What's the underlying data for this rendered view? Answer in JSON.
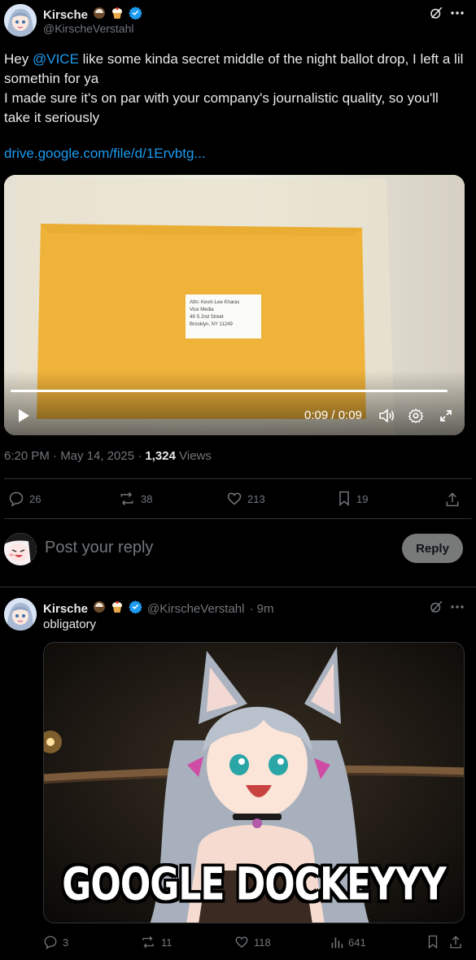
{
  "tweet": {
    "author_name": "Kirsche",
    "author_handle": "@KirscheVerstahl",
    "text_prefix": "Hey ",
    "mention": "@VICE",
    "text_rest": " like some kinda secret middle of the night ballot drop, I left a lil somethin for ya",
    "text_line2": "I made sure it's on par with your company's journalistic quality, so you'll take it seriously",
    "link_text": "drive.google.com/file/d/1Ervbtg...",
    "video": {
      "envelope_label": [
        "Attn: Kevin Lee Kharas",
        "Vice Media",
        "49 S 2nd Street",
        "Brooklyn, NY 11249"
      ],
      "time": "0:09 / 0:09",
      "progress": 1.0
    },
    "meta_time": "6:20 PM · May 14, 2025 · ",
    "views_count": "1,324",
    "views_label": " Views",
    "stats": {
      "replies": "26",
      "reposts": "38",
      "likes": "213",
      "bookmarks": "19"
    }
  },
  "composer": {
    "placeholder": "Post your reply",
    "reply_button": "Reply"
  },
  "reply": {
    "author_name": "Kirsche",
    "author_handle": "@KirscheVerstahl",
    "time": "· 9m",
    "text": "obligatory",
    "image_caption": "GOOGLE DOCKEYYY",
    "stats": {
      "replies": "3",
      "reposts": "11",
      "likes": "118",
      "views": "641"
    }
  },
  "colors": {
    "accent": "#1d9bf0",
    "muted": "#71767b",
    "background": "#000000",
    "envelope": "#f0b33a"
  }
}
